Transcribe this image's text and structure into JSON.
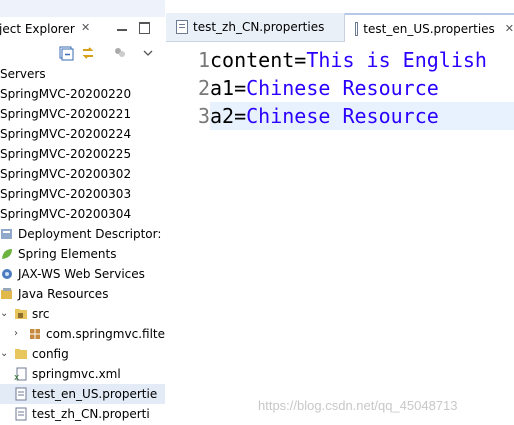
{
  "explorer": {
    "title": "ject Explorer",
    "close": "✕",
    "items": [
      {
        "label": "Servers",
        "icon": "none",
        "twisty": ""
      },
      {
        "label": "SpringMVC-20200220",
        "icon": "none",
        "twisty": ""
      },
      {
        "label": "SpringMVC-20200221",
        "icon": "none",
        "twisty": ""
      },
      {
        "label": "SpringMVC-20200224",
        "icon": "none",
        "twisty": ""
      },
      {
        "label": "SpringMVC-20200225",
        "icon": "none",
        "twisty": ""
      },
      {
        "label": "SpringMVC-20200302",
        "icon": "none",
        "twisty": ""
      },
      {
        "label": "SpringMVC-20200303",
        "icon": "none",
        "twisty": ""
      },
      {
        "label": "SpringMVC-20200304",
        "icon": "none",
        "twisty": ""
      },
      {
        "label": "Deployment Descriptor: S",
        "icon": "descriptor-icon",
        "twisty": ""
      },
      {
        "label": "Spring Elements",
        "icon": "spring-leaf-icon",
        "twisty": ""
      },
      {
        "label": "JAX-WS Web Services",
        "icon": "webservice-icon",
        "twisty": ""
      },
      {
        "label": "Java Resources",
        "icon": "java-resources-icon",
        "twisty": ""
      },
      {
        "label": "src",
        "icon": "source-folder-icon",
        "twisty": "expanded"
      },
      {
        "label": "com.springmvc.filter",
        "icon": "package-icon",
        "twisty": "collapsed"
      },
      {
        "label": "config",
        "icon": "folder-icon",
        "twisty": "expanded"
      },
      {
        "label": "springmvc.xml",
        "icon": "xml-file-icon",
        "twisty": ""
      },
      {
        "label": "test_en_US.propertie",
        "icon": "properties-file-icon",
        "twisty": "",
        "selected": true
      },
      {
        "label": "test_zh_CN.properti",
        "icon": "properties-file-icon",
        "twisty": ""
      }
    ]
  },
  "editor": {
    "tabs": [
      {
        "label": "test_zh_CN.properties",
        "active": false
      },
      {
        "label": "test_en_US.properties",
        "active": true,
        "close": "✕"
      }
    ],
    "lines": [
      {
        "num": "1",
        "key": "content",
        "eq": "=",
        "value": "This is English"
      },
      {
        "num": "2",
        "key": "a1",
        "eq": "=",
        "value": "Chinese Resource"
      },
      {
        "num": "3",
        "key": "a2",
        "eq": "=",
        "value": "Chinese Resource",
        "current": true
      }
    ]
  },
  "watermark": "https://blog.csdn.net/qq_45048713",
  "colors": {
    "value": "#2a00ff",
    "selection": "#e3ebf7",
    "current_line": "#e8f2fe"
  }
}
